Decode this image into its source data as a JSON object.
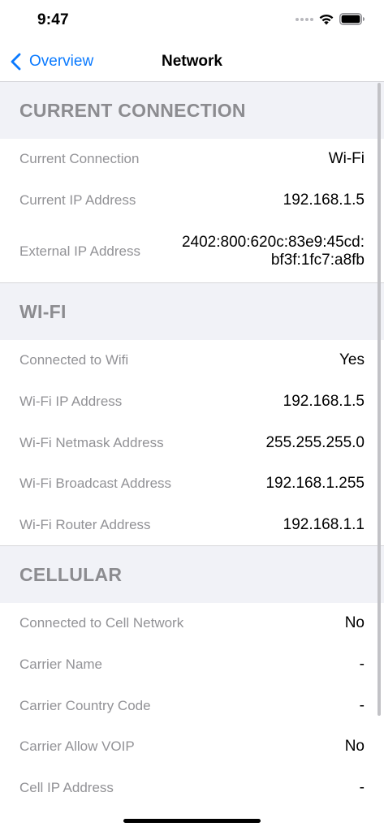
{
  "status_bar": {
    "time": "9:47"
  },
  "nav": {
    "back_label": "Overview",
    "title": "Network"
  },
  "sections": [
    {
      "header": "CURRENT CONNECTION",
      "rows": [
        {
          "label": "Current Connection",
          "value": "Wi-Fi"
        },
        {
          "label": "Current IP Address",
          "value": "192.168.1.5"
        },
        {
          "label": "External IP Address",
          "value_line1": "2402:800:620c:83e9:45cd:",
          "value_line2": "bf3f:1fc7:a8fb"
        }
      ]
    },
    {
      "header": "WI-FI",
      "rows": [
        {
          "label": "Connected to Wifi",
          "value": "Yes"
        },
        {
          "label": "Wi-Fi IP Address",
          "value": "192.168.1.5"
        },
        {
          "label": "Wi-Fi Netmask Address",
          "value": "255.255.255.0"
        },
        {
          "label": "Wi-Fi Broadcast Address",
          "value": "192.168.1.255"
        },
        {
          "label": "Wi-Fi Router Address",
          "value": "192.168.1.1"
        }
      ]
    },
    {
      "header": "CELLULAR",
      "rows": [
        {
          "label": "Connected to Cell Network",
          "value": "No"
        },
        {
          "label": "Carrier Name",
          "value": "-"
        },
        {
          "label": "Carrier Country Code",
          "value": "-"
        },
        {
          "label": "Carrier Allow VOIP",
          "value": "No"
        },
        {
          "label": "Cell IP Address",
          "value": "-"
        }
      ]
    }
  ],
  "colors": {
    "accent": "#0a7aff",
    "section_bg": "#f1f2f7",
    "label_text": "#929296",
    "header_text": "#8c8c90"
  },
  "icons": {
    "back": "chevron-left-icon",
    "wifi": "wifi-icon",
    "battery": "battery-icon",
    "signal": "signal-dots-icon"
  }
}
